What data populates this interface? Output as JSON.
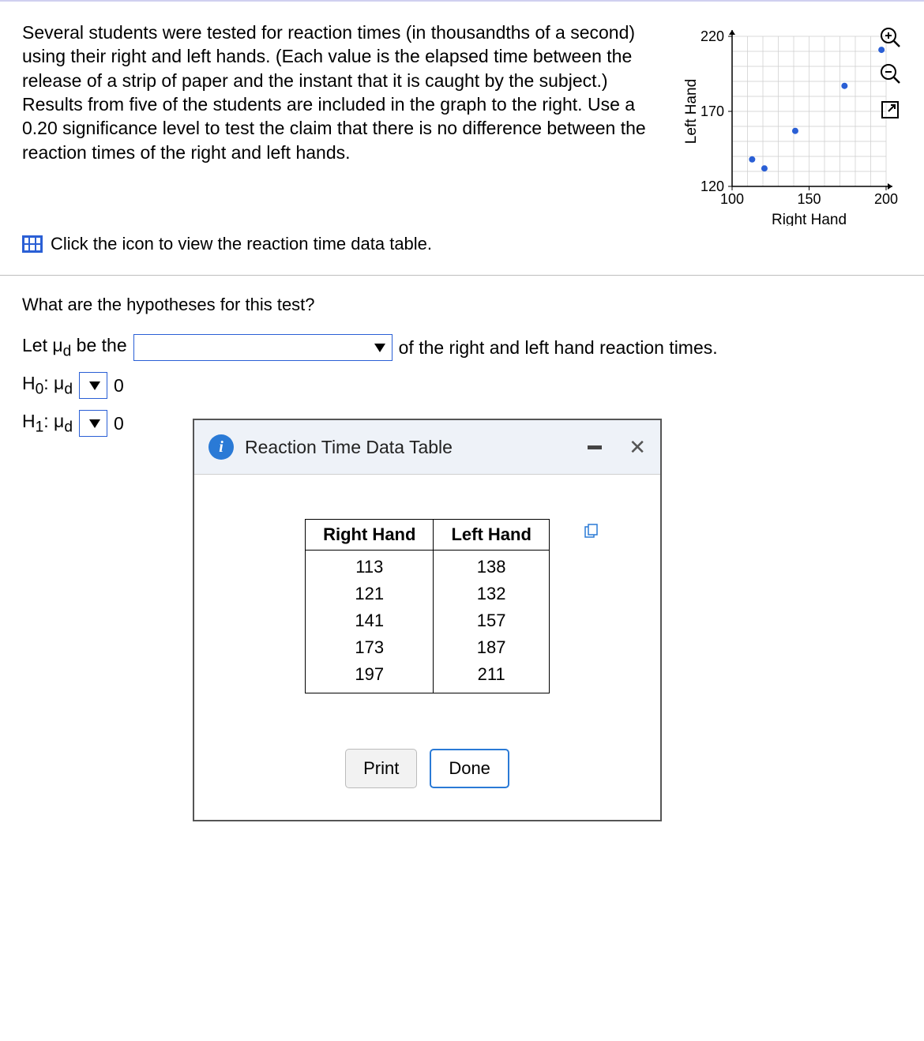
{
  "problem_text": "Several students were tested for reaction times (in thousandths of a second) using their right and left hands. (Each value is the elapsed time between the release of a strip of paper and the instant that it is caught by the subject.) Results from five of the students are included in the graph to the right. Use a 0.20 significance level to test the claim that there is no difference between the reaction times of the right and left hands.",
  "table_link": "Click the icon to view the reaction time data table.",
  "question": {
    "title": "What are the hypotheses for this test?",
    "line1_prefix": "Let μ",
    "line1_sub": "d",
    "line1_be": " be the ",
    "line1_suffix": " of the right and left hand reaction times.",
    "h0_label": "H",
    "h0_sub": "0",
    "h0_symbol": ": μ",
    "h0_symbol_sub": "d",
    "h0_rhs": "0",
    "h1_label": "H",
    "h1_sub": "1",
    "h1_symbol": ": μ",
    "h1_symbol_sub": "d",
    "h1_rhs": "0"
  },
  "modal": {
    "title": "Reaction Time Data Table",
    "headers": [
      "Right Hand",
      "Left Hand"
    ],
    "rows": [
      [
        113,
        138
      ],
      [
        121,
        132
      ],
      [
        141,
        157
      ],
      [
        173,
        187
      ],
      [
        197,
        211
      ]
    ],
    "print": "Print",
    "done": "Done"
  },
  "chart_data": {
    "type": "scatter",
    "xlabel": "Right Hand",
    "ylabel": "Left Hand",
    "xlim": [
      100,
      200
    ],
    "ylim": [
      120,
      220
    ],
    "xticks": [
      100,
      150,
      200
    ],
    "yticks": [
      120,
      170,
      220
    ],
    "points": [
      {
        "x": 113,
        "y": 138
      },
      {
        "x": 121,
        "y": 132
      },
      {
        "x": 141,
        "y": 157
      },
      {
        "x": 173,
        "y": 187
      },
      {
        "x": 197,
        "y": 211
      }
    ]
  }
}
